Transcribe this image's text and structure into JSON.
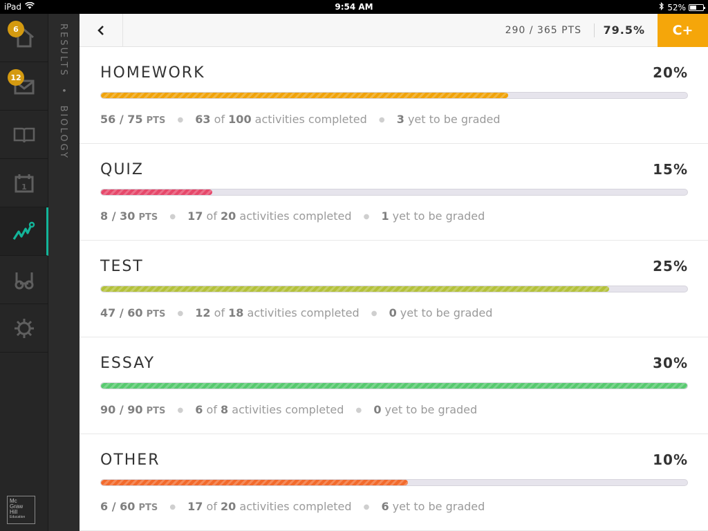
{
  "status_bar": {
    "device": "iPad",
    "time": "9:54 AM",
    "battery": "52%",
    "battery_level": 0.52
  },
  "rail": {
    "items": [
      {
        "icon": "home-icon",
        "badge": "6"
      },
      {
        "icon": "mail-icon",
        "badge": "12"
      },
      {
        "icon": "book-icon",
        "badge": ""
      },
      {
        "icon": "calendar-icon",
        "badge": ""
      },
      {
        "icon": "results-chart-icon",
        "badge": "",
        "active": true
      },
      {
        "icon": "glasses-icon",
        "badge": ""
      },
      {
        "icon": "settings-gear-icon",
        "badge": ""
      }
    ],
    "logo_lines": [
      "Mc",
      "Graw",
      "Hill",
      "Education"
    ],
    "active_color": "#13b59a"
  },
  "breadcrumb": {
    "section": "RESULTS",
    "course": "BIOLOGY"
  },
  "header": {
    "points": "290 / 365 PTS",
    "percent": "79.5%",
    "grade": "C+",
    "grade_color": "#f5a60a"
  },
  "categories": [
    {
      "name": "HOMEWORK",
      "weight": "20%",
      "progress": 0.695,
      "color": "#f0a30a",
      "pts": "56 / 75",
      "pts_unit": "PTS",
      "done": "63",
      "of_word": "of",
      "total": "100",
      "activities_text": "activities completed",
      "ungraded": "3",
      "ungraded_text": "yet to be graded"
    },
    {
      "name": "QUIZ",
      "weight": "15%",
      "progress": 0.19,
      "color": "#e6486a",
      "pts": "8 / 30",
      "pts_unit": "PTS",
      "done": "17",
      "of_word": "of",
      "total": "20",
      "activities_text": "activities completed",
      "ungraded": "1",
      "ungraded_text": "yet to be graded"
    },
    {
      "name": "TEST",
      "weight": "25%",
      "progress": 0.867,
      "color": "#b3c13a",
      "pts": "47 / 60",
      "pts_unit": "PTS",
      "done": "12",
      "of_word": "of",
      "total": "18",
      "activities_text": "activities completed",
      "ungraded": "0",
      "ungraded_text": "yet to be graded"
    },
    {
      "name": "ESSAY",
      "weight": "30%",
      "progress": 1.0,
      "color": "#57c96f",
      "pts": "90 / 90",
      "pts_unit": "PTS",
      "done": "6",
      "of_word": "of",
      "total": "8",
      "activities_text": "activities completed",
      "ungraded": "0",
      "ungraded_text": "yet to be graded"
    },
    {
      "name": "OTHER",
      "weight": "10%",
      "progress": 0.523,
      "color": "#f26a2c",
      "pts": "6 / 60",
      "pts_unit": "PTS",
      "done": "17",
      "of_word": "of",
      "total": "20",
      "activities_text": "activities completed",
      "ungraded": "6",
      "ungraded_text": "yet to be graded"
    }
  ]
}
